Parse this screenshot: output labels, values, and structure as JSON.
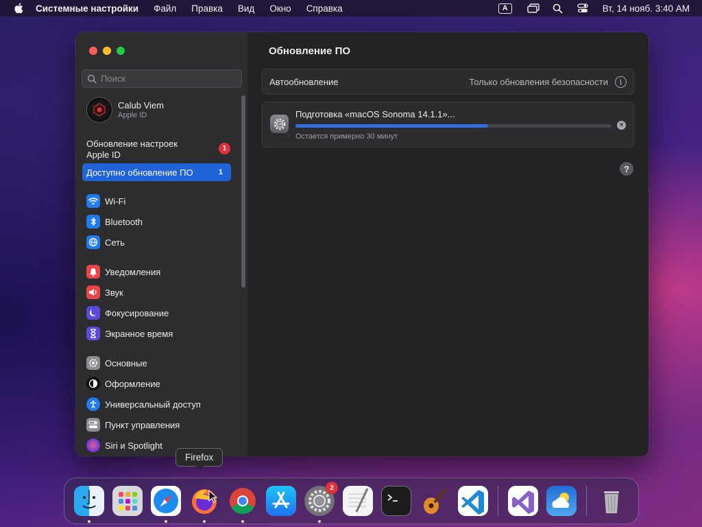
{
  "menubar": {
    "app_name": "Системные настройки",
    "items": [
      "Файл",
      "Правка",
      "Вид",
      "Окно",
      "Справка"
    ],
    "input_source": "A",
    "clock": "Вт, 14 нояб. 3:40 AM"
  },
  "window": {
    "title": "Обновление ПО",
    "search_placeholder": "Поиск",
    "account": {
      "name": "Calub Viem",
      "subtitle": "Apple ID"
    },
    "alert_item": {
      "label": "Обновление настроек Apple ID",
      "badge": "1"
    },
    "selected_item": {
      "label": "Доступно обновление ПО",
      "count": "1"
    },
    "groups": [
      [
        {
          "label": "Wi-Fi",
          "icon": "wifi-icon",
          "color": "#1f7cf0"
        },
        {
          "label": "Bluetooth",
          "icon": "bluetooth-icon",
          "color": "#1f7cf0"
        },
        {
          "label": "Сеть",
          "icon": "globe-icon",
          "color": "#1f7cf0"
        }
      ],
      [
        {
          "label": "Уведомления",
          "icon": "bell-icon",
          "color": "#e8454d"
        },
        {
          "label": "Звук",
          "icon": "speaker-icon",
          "color": "#e8454d"
        },
        {
          "label": "Фокусирование",
          "icon": "moon-icon",
          "color": "#5a4bd8"
        },
        {
          "label": "Экранное время",
          "icon": "hourglass-icon",
          "color": "#5a4bd8"
        }
      ],
      [
        {
          "label": "Основные",
          "icon": "gear-icon",
          "color": "#8e8d92"
        },
        {
          "label": "Оформление",
          "icon": "appearance-icon",
          "color": "#111111"
        },
        {
          "label": "Универсальный доступ",
          "icon": "accessibility-icon",
          "color": "#1f7cf0"
        },
        {
          "label": "Пункт управления",
          "icon": "control-center-icon",
          "color": "#8e8d92"
        },
        {
          "label": "Siri и Spotlight",
          "icon": "siri-icon",
          "color": "#b8417e"
        }
      ]
    ],
    "auto_update": {
      "label": "Автообновление",
      "value": "Только обновления безопасности"
    },
    "update": {
      "title": "Подготовка «macOS Sonoma 14.1.1»...",
      "remaining": "Остается примерно 30 минут",
      "progress": 0.61
    }
  },
  "tooltip": "Firefox",
  "dock": {
    "apps": [
      {
        "name": "finder",
        "running": true
      },
      {
        "name": "launchpad",
        "running": false
      },
      {
        "name": "safari",
        "running": true
      },
      {
        "name": "firefox",
        "running": true
      },
      {
        "name": "chrome",
        "running": true
      },
      {
        "name": "app-store",
        "running": false
      },
      {
        "name": "system-settings",
        "running": true,
        "badge": "2"
      },
      {
        "name": "textedit",
        "running": false
      },
      {
        "name": "terminal",
        "running": false
      },
      {
        "name": "garageband",
        "running": false
      },
      {
        "name": "vscode",
        "running": false
      },
      {
        "name": "visual-studio",
        "running": false
      },
      {
        "name": "weather",
        "running": false
      },
      {
        "name": "trash",
        "running": false
      }
    ]
  }
}
